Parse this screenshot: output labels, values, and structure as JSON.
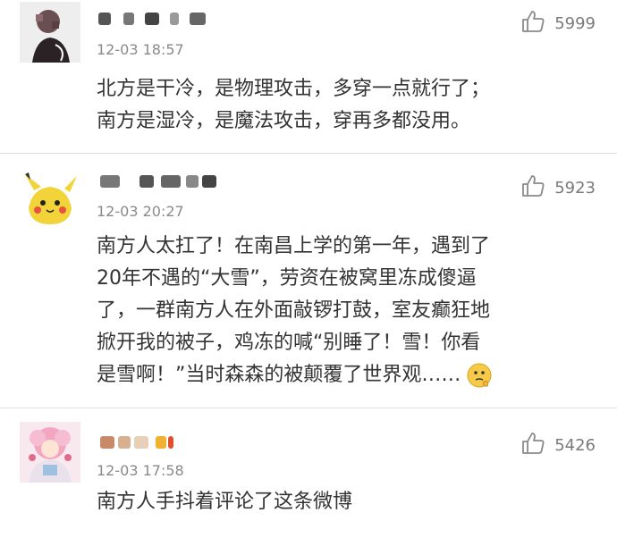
{
  "comments": [
    {
      "time": "12-03 18:57",
      "likes": "5999",
      "lines": [
        "北方是干冷，是物理攻击，多穿一点就行了；",
        "南方是湿冷，是魔法攻击，穿再多都没用。"
      ]
    },
    {
      "time": "12-03 20:27",
      "likes": "5923",
      "lines": [
        "南方人太扛了！在南昌上学的第一年，遇到了",
        "20年不遇的“大雪”，劳资在被窝里冻成傻逼",
        "了，一群南方人在外面敲锣打鼓，室友癫狂地",
        "掀开我的被子，鸡冻的喊“别睡了！雪！你看",
        "是雪啊！”当时森森的被颠覆了世界观……"
      ]
    },
    {
      "time": "12-03 17:58",
      "likes": "5426",
      "lines": [
        "南方人手抖着评论了这条微博"
      ]
    }
  ]
}
